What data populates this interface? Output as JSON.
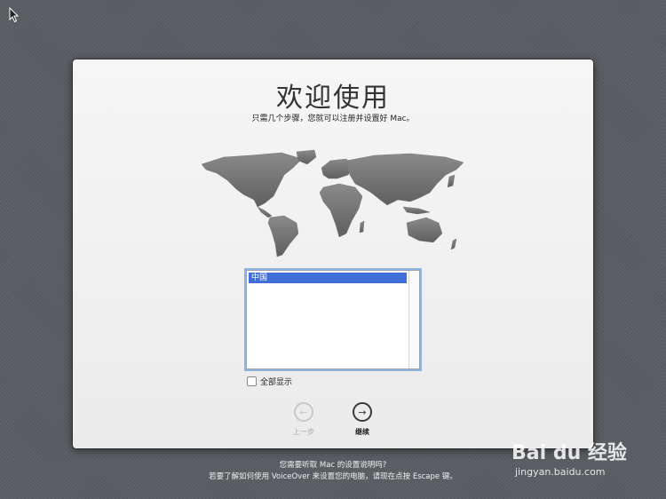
{
  "welcome": {
    "title": "欢迎使用",
    "subtitle": "只需几个步骤，您就可以注册并设置好 Mac。"
  },
  "country_list": {
    "items": [
      "中国"
    ],
    "selected": "中国"
  },
  "show_all": {
    "label": "全部显示",
    "checked": false
  },
  "nav": {
    "back_label": "上一步",
    "continue_label": "继续"
  },
  "footer": {
    "line1": "您需要听取 Mac 的设置说明吗?",
    "line2": "若要了解如何使用 VoiceOver 来设置您的电脑，请现在点按 Escape 键。"
  },
  "watermark": {
    "logo": "Bai du 经验",
    "url": "jingyan.baidu.com"
  },
  "colors": {
    "background": "#5a5d62",
    "selection": "#3f6fd6",
    "focus_ring": "#8fb3e3"
  },
  "icons": [
    "pointer-cursor-icon",
    "world-map",
    "arrow-left-icon",
    "arrow-right-icon",
    "checkbox-icon"
  ]
}
